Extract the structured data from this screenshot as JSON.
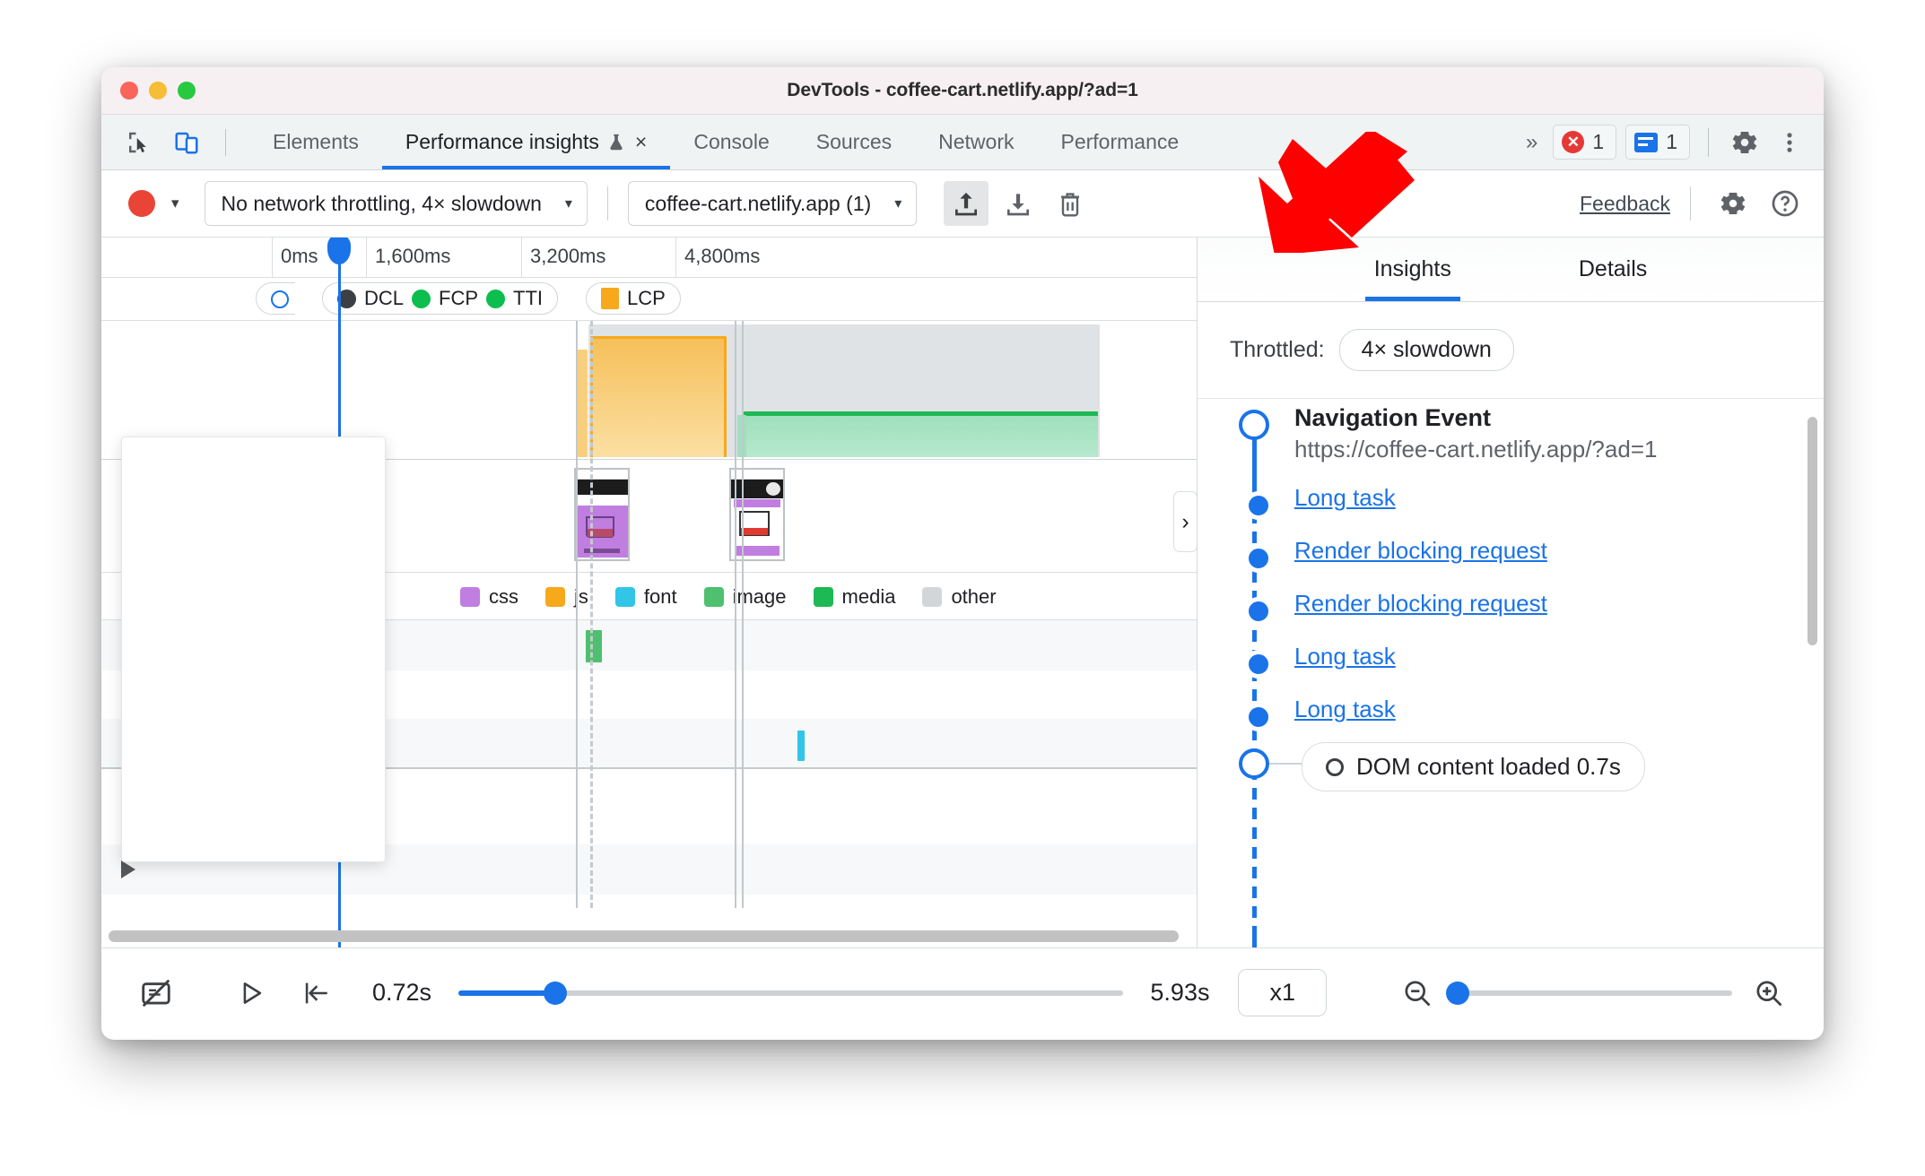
{
  "window": {
    "title": "DevTools - coffee-cart.netlify.app/?ad=1",
    "traffic_lights": [
      "close",
      "minimize",
      "maximize"
    ]
  },
  "tabbar": {
    "left_icons": [
      "inspect-element-icon",
      "device-toolbar-icon"
    ],
    "tabs": [
      {
        "label": "Elements",
        "active": false
      },
      {
        "label": "Performance insights",
        "active": true,
        "experimental_icon": "flask-icon",
        "close_icon": "×"
      },
      {
        "label": "Console",
        "active": false
      },
      {
        "label": "Sources",
        "active": false
      },
      {
        "label": "Network",
        "active": false
      },
      {
        "label": "Performance",
        "active": false
      }
    ],
    "more_tabs_icon": "»",
    "error_badge": {
      "icon": "error-icon",
      "count": "1"
    },
    "message_badge": {
      "icon": "message-icon",
      "count": "1"
    },
    "settings_icon": "gear-icon",
    "menu_icon": "kebab-menu-icon"
  },
  "toolbar": {
    "record_button": "record-icon",
    "record_caret": "▾",
    "throttling_select": {
      "value": "No network throttling, 4× slowdown",
      "caret": "▾"
    },
    "trace_select": {
      "value": "coffee-cart.netlify.app (1)",
      "caret": "▾"
    },
    "upload_icon": "upload-icon",
    "download_icon": "download-icon",
    "delete_icon": "trash-icon",
    "feedback_label": "Feedback",
    "settings_icon": "gear-icon",
    "help_icon": "help-icon",
    "cursor_annotation": "red-arrow-pointing-at-upload-button"
  },
  "timeline": {
    "ruler_ticks": [
      "0ms",
      "1,600ms",
      "3,200ms",
      "4,800ms"
    ],
    "markers_pill": [
      {
        "label": "DCL",
        "color": "#3c4043",
        "shape": "circle"
      },
      {
        "label": "FCP",
        "color": "#0bbe4e",
        "shape": "circle"
      },
      {
        "label": "TTI",
        "color": "#0bbe4e",
        "shape": "circle"
      }
    ],
    "lcp_pill": {
      "label": "LCP",
      "color": "#f7a81b",
      "shape": "square"
    },
    "legend": [
      {
        "label": "css",
        "color": "#c07ee0"
      },
      {
        "label": "js",
        "color": "#f7a81b"
      },
      {
        "label": "font",
        "color": "#31c6e8"
      },
      {
        "label": "image",
        "color": "#4ec06f"
      },
      {
        "label": "media",
        "color": "#1db954"
      },
      {
        "label": "other",
        "color": "#d3d6d9"
      }
    ],
    "expand_arrows": [
      "collapsed-track-1",
      "collapsed-track-2"
    ],
    "collapse_handle_icon": "chevron-right-icon",
    "filmstrip_thumbnails": [
      "screenshot-1",
      "screenshot-2"
    ],
    "popup_overlay": "empty-tooltip-popup"
  },
  "sidepanel": {
    "tabs": [
      {
        "label": "Insights",
        "active": true
      },
      {
        "label": "Details",
        "active": false
      }
    ],
    "throttled_label": "Throttled:",
    "throttled_value": "4× slowdown",
    "navigation": {
      "title": "Navigation Event",
      "url": "https://coffee-cart.netlify.app/?ad=1"
    },
    "items": [
      {
        "label": "Long task",
        "type": "link"
      },
      {
        "label": "Render blocking request",
        "type": "link"
      },
      {
        "label": "Render blocking request",
        "type": "link"
      },
      {
        "label": "Long task",
        "type": "link"
      },
      {
        "label": "Long task",
        "type": "link"
      }
    ],
    "dom_content_loaded": "DOM content loaded 0.7s"
  },
  "bottombar": {
    "screenshot_toggle_icon": "screenshots-off-icon",
    "play_icon": "play-icon",
    "jump_to_start_icon": "jump-to-start-icon",
    "start_time": "0.72s",
    "end_time": "5.93s",
    "speed": "x1",
    "zoom_out_icon": "zoom-out-icon",
    "zoom_in_icon": "zoom-in-icon"
  },
  "colors": {
    "accent": "#1a73e8",
    "record": "#ea4436",
    "error": "#e53935",
    "js": "#f7a81b",
    "css": "#c07ee0",
    "media": "#1db954",
    "font": "#31c6e8",
    "titlebar": "#f7f0f3",
    "tabbar": "#eff3f4"
  }
}
